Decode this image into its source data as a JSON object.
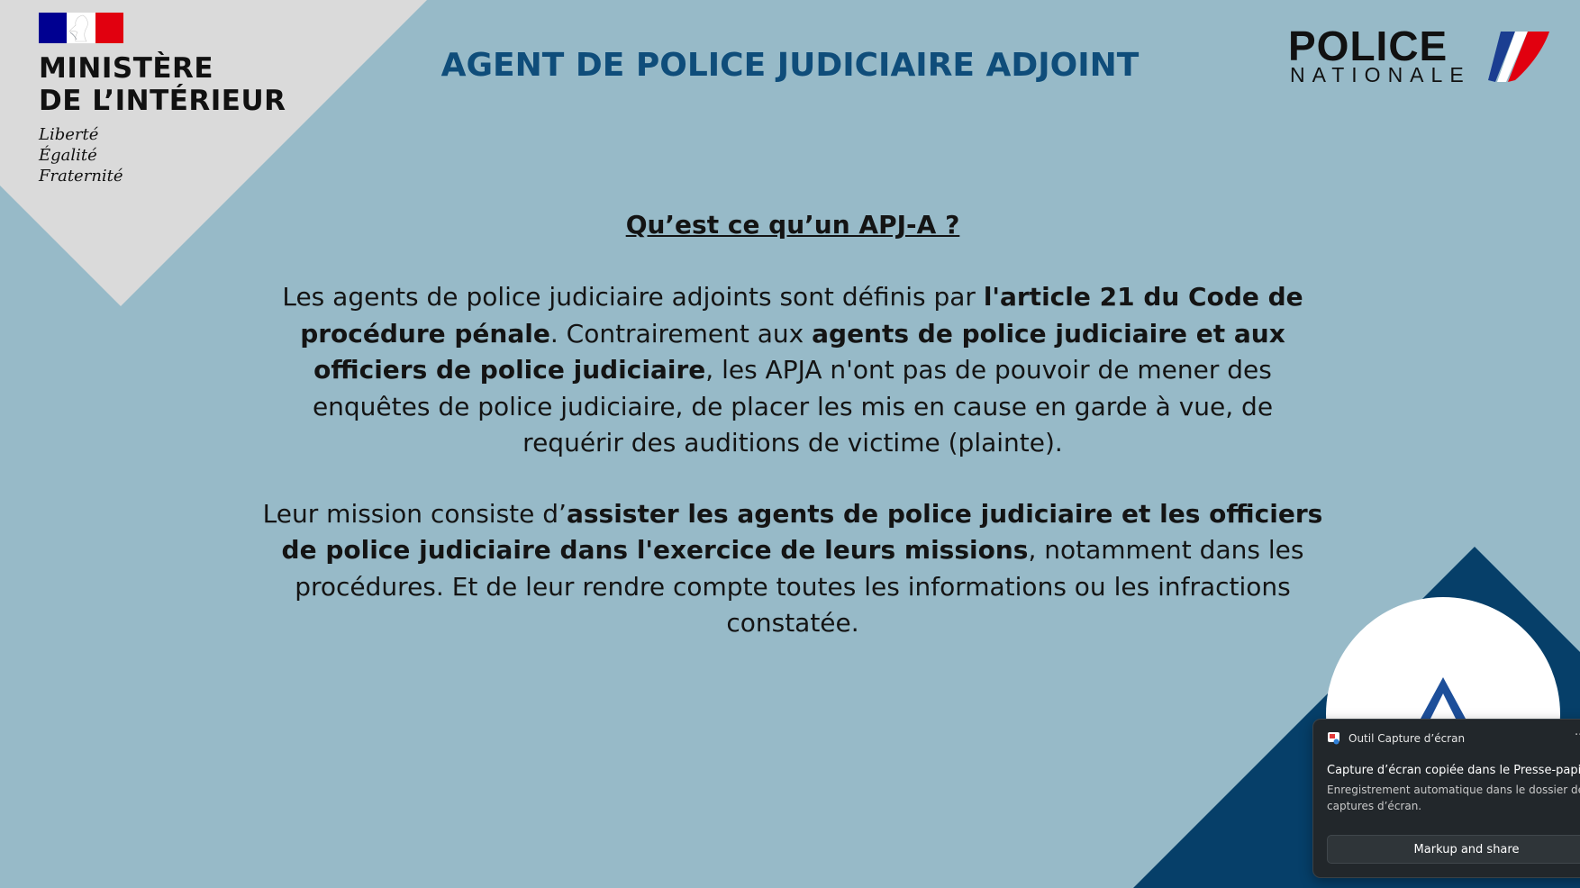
{
  "colors": {
    "background": "#97bac8",
    "corner_grey": "#dadada",
    "corner_navy": "#063f69",
    "title_blue": "#0f4d7a",
    "toast_bg": "#22272b"
  },
  "ministry": {
    "name_line1": "MINISTÈRE",
    "name_line2": "DE L’INTÉRIEUR",
    "motto_line1": "Liberté",
    "motto_line2": "Égalité",
    "motto_line3": "Fraternité"
  },
  "header": {
    "title": "AGENT DE POLICE JUDICIAIRE ADJOINT"
  },
  "police_logo": {
    "word1": "POLICE",
    "word2": "NATIONALE"
  },
  "content": {
    "question": "Qu’est ce qu’un APJ-A ?",
    "p1": {
      "t1": "Les agents de police judiciaire adjoints sont définis par ",
      "b1": "l'article 21 du Code de procédure pénale",
      "t2": ". Contrairement aux ",
      "b2": "agents de police judiciaire et aux officiers de police judiciaire",
      "t3": ", les APJA n'ont pas de pouvoir de mener des enquêtes de police judiciaire, de placer les mis en cause en garde à vue, de requérir des auditions de victime (plainte)."
    },
    "p2": {
      "t1": "Leur mission consiste d’",
      "b1": "assister les agents de police judiciaire et les officiers de police judiciaire dans l'exercice de leurs missions",
      "t2": ", notamment dans les procédures. Et de leur rendre compte toutes les informations ou les infractions constatée."
    }
  },
  "toast": {
    "app_name": "Outil Capture d’écran",
    "more": "···",
    "title": "Capture d’écran copiée dans le Presse-papiers",
    "body": "Enregistrement automatique dans le dossier des captures d’écran.",
    "button_label": "Markup and share"
  }
}
